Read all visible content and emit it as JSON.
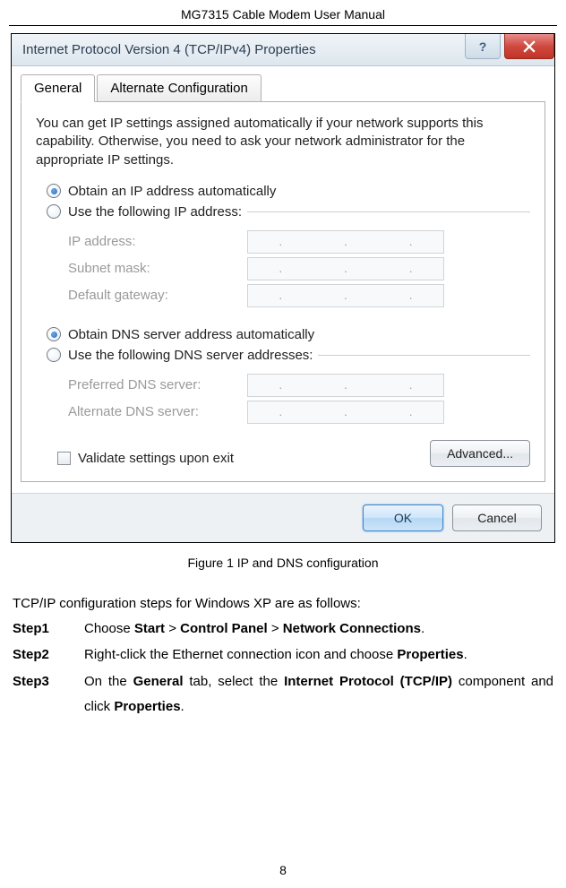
{
  "header": "MG7315 Cable Modem User Manual",
  "dialog": {
    "title": "Internet Protocol Version 4 (TCP/IPv4) Properties",
    "tabs": [
      "General",
      "Alternate Configuration"
    ],
    "intro": "You can get IP settings assigned automatically if your network supports this capability. Otherwise, you need to ask your network administrator for the appropriate IP settings.",
    "radio_ip_auto": "Obtain an IP address automatically",
    "radio_ip_manual": "Use the following IP address:",
    "ip_fields": {
      "ip_address": "IP address:",
      "subnet_mask": "Subnet mask:",
      "default_gateway": "Default gateway:"
    },
    "radio_dns_auto": "Obtain DNS server address automatically",
    "radio_dns_manual": "Use the following DNS server addresses:",
    "dns_fields": {
      "preferred": "Preferred DNS server:",
      "alternate": "Alternate DNS server:"
    },
    "validate_checkbox": "Validate settings upon exit",
    "advanced_button": "Advanced...",
    "ok_button": "OK",
    "cancel_button": "Cancel"
  },
  "caption": "Figure 1 IP and DNS configuration",
  "intro_line": "TCP/IP configuration steps for Windows XP are as follows:",
  "steps": [
    {
      "label": "Step1",
      "prefix": "Choose ",
      "bold1": "Start",
      "mid1": " > ",
      "bold2": "Control Panel",
      "mid2": " > ",
      "bold3": "Network Connections",
      "suffix": "."
    },
    {
      "label": "Step2",
      "prefix": "Right-click the Ethernet connection icon and choose ",
      "bold1": "Properties",
      "suffix": "."
    },
    {
      "label": "Step3",
      "prefix": "On the ",
      "bold1": "General",
      "mid1": " tab, select the ",
      "bold2": "Internet Protocol (TCP/IP)",
      "mid2": " component and click ",
      "bold3": "Properties",
      "suffix": "."
    }
  ],
  "page_number": "8"
}
